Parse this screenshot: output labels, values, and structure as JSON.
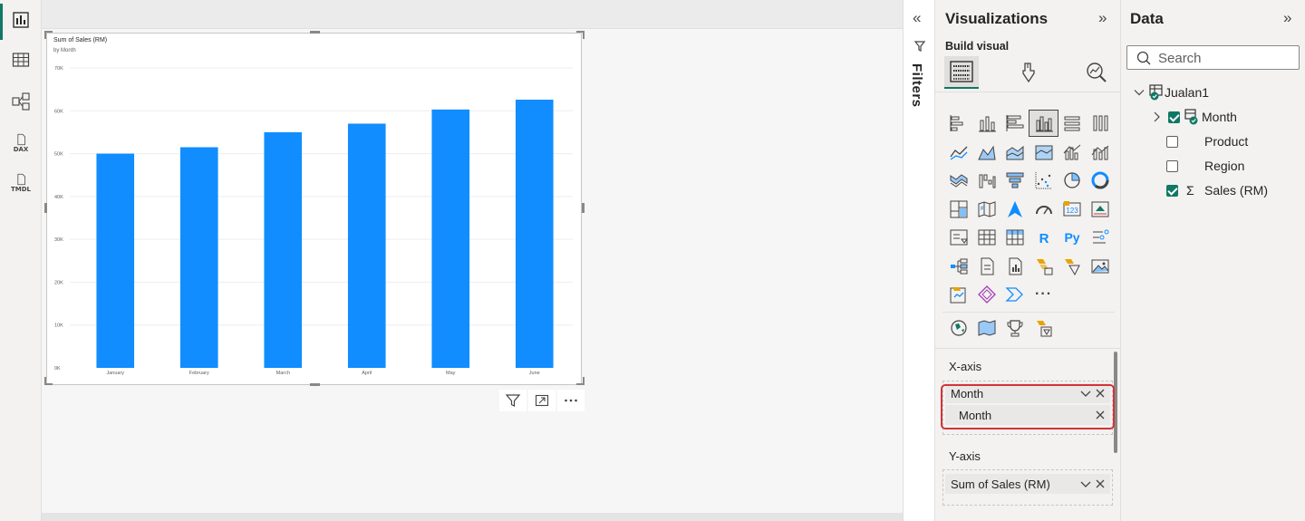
{
  "rail": {
    "items": [
      {
        "name": "report-view",
        "label": ""
      },
      {
        "name": "table-view",
        "label": ""
      },
      {
        "name": "model-view",
        "label": ""
      },
      {
        "name": "dax-query-view",
        "label": "DAX"
      },
      {
        "name": "tmdl-view",
        "label": "TMDL"
      }
    ]
  },
  "visual": {
    "title": "Sum of Sales (RM)",
    "subtitle": "by Month"
  },
  "chart_data": {
    "type": "bar",
    "title": "Sum of Sales (RM)",
    "subtitle": "by Month",
    "categories": [
      "January",
      "February",
      "March",
      "April",
      "May",
      "June"
    ],
    "values": [
      50000,
      51500,
      55000,
      57000,
      60300,
      62600
    ],
    "yticks": [
      "0K",
      "10K",
      "20K",
      "30K",
      "40K",
      "50K",
      "60K",
      "70K"
    ],
    "ylim": [
      0,
      70000
    ],
    "grid": true,
    "bar_color": "#118dff"
  },
  "filters": {
    "label": "Filters"
  },
  "visualizations": {
    "title": "Visualizations",
    "build_label": "Build visual",
    "x_axis_label": "X-axis",
    "x_axis_field": "Month",
    "x_axis_subfield": "Month",
    "y_axis_label": "Y-axis",
    "y_axis_field": "Sum of Sales (RM)",
    "more": "···"
  },
  "data_pane": {
    "title": "Data",
    "search_placeholder": "Search",
    "table_name": "Jualan1",
    "fields": [
      {
        "label": "Month",
        "checked": true
      },
      {
        "label": "Product",
        "checked": false
      },
      {
        "label": "Region",
        "checked": false
      },
      {
        "label": "Sales (RM)",
        "checked": true,
        "sigma": "Σ"
      }
    ]
  },
  "colors": {
    "accent": "#117865",
    "bar": "#118dff",
    "highlight": "#d13438"
  }
}
